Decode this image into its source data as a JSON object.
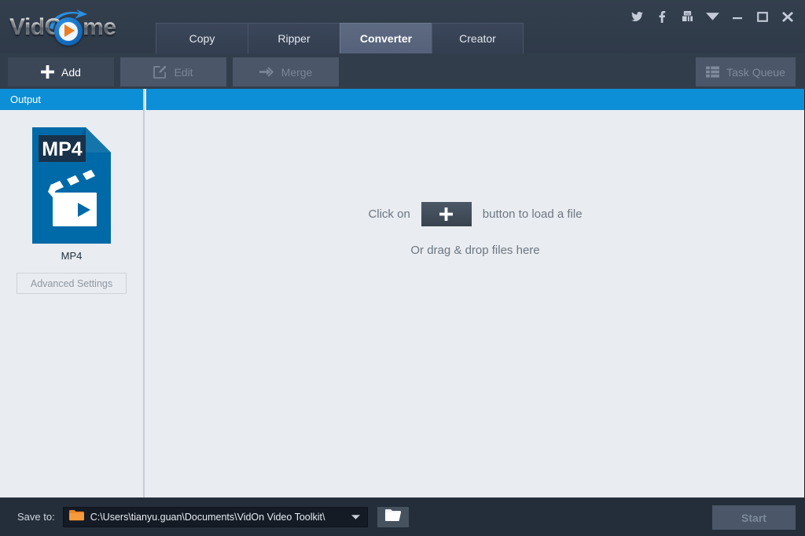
{
  "app": {
    "logo_part1": "Vid",
    "logo_part2": "n.me",
    "logo_full": "VidOn.me"
  },
  "titlebar": {
    "tabs": [
      {
        "label": "Copy",
        "active": false
      },
      {
        "label": "Ripper",
        "active": false
      },
      {
        "label": "Converter",
        "active": true
      },
      {
        "label": "Creator",
        "active": false
      }
    ],
    "window_icons": [
      {
        "name": "twitter-icon",
        "title": "Twitter"
      },
      {
        "name": "facebook-icon",
        "title": "Facebook"
      },
      {
        "name": "youtube-icon",
        "title": "YouTube"
      },
      {
        "name": "chevron-down-icon",
        "title": "More"
      },
      {
        "name": "minimize-icon",
        "title": "Minimize"
      },
      {
        "name": "maximize-icon",
        "title": "Maximize"
      },
      {
        "name": "close-icon",
        "title": "Close"
      }
    ]
  },
  "toolbar": {
    "add_label": "Add",
    "edit_label": "Edit",
    "merge_label": "Merge",
    "task_queue_label": "Task Queue"
  },
  "sidebar": {
    "header": "Output",
    "format_badge": "MP4",
    "format_label": "MP4",
    "advanced_settings_label": "Advanced Settings"
  },
  "content": {
    "drop_prefix": "Click on",
    "drop_suffix": "button to load a file",
    "drop_hint": "Or drag & drop files here",
    "plus_glyph": "+"
  },
  "footer": {
    "save_to_label": "Save to:",
    "save_path": "C:\\Users\\tianyu.guan\\Documents\\VidOn Video Toolkit\\",
    "start_label": "Start"
  },
  "colors": {
    "accent_blue": "#0c8fd6",
    "logo_orange": "#ef7d22",
    "titlebar_dark": "#333e4d",
    "footer_dark": "#242e3b",
    "panel_light": "#e9ecf0"
  }
}
